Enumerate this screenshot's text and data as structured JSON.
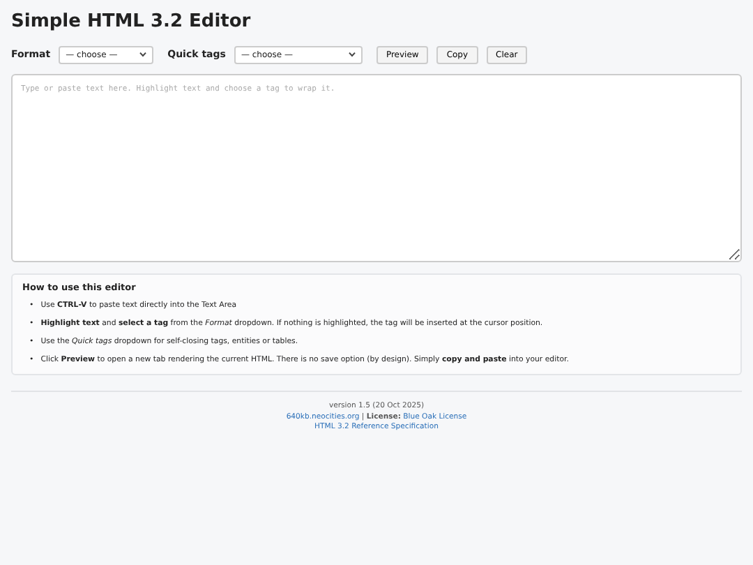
{
  "title": "Simple HTML 3.2 Editor",
  "toolbar": {
    "format_label": "Format",
    "format_select": "— choose —",
    "quick_label": "Quick tags",
    "quick_select": "— choose —",
    "buttons": [
      "Preview",
      "Copy",
      "Clear"
    ]
  },
  "editor": {
    "placeholder": "Type or paste text here. Highlight text and choose a tag to wrap it."
  },
  "help": {
    "heading": "How to use this editor",
    "items": [
      {
        "bullet": "•",
        "text": "Use **CTRL-V** to paste text directly into the Text Area"
      },
      {
        "bullet": "•",
        "text": "**Highlight text** and **select a tag** from the *Format* dropdown. If nothing is highlighted, the tag will be inserted at the cursor position."
      },
      {
        "bullet": "•",
        "text": "Use the *Quick tags* dropdown for self-closing tags, entities or tables."
      },
      {
        "bullet": "•",
        "text": "Click **Preview** to open a new tab rendering the current HTML. There is no save option (by design). Simply **copy and paste** into your editor."
      }
    ]
  },
  "footer": {
    "version": "version 1.5 (20 Oct 2025)",
    "site_link": "640kb.neocities.org",
    "separator": "|",
    "license_label": "License:",
    "license_link": "Blue Oak License",
    "spec_link": "HTML 3.2 Reference Specification"
  }
}
